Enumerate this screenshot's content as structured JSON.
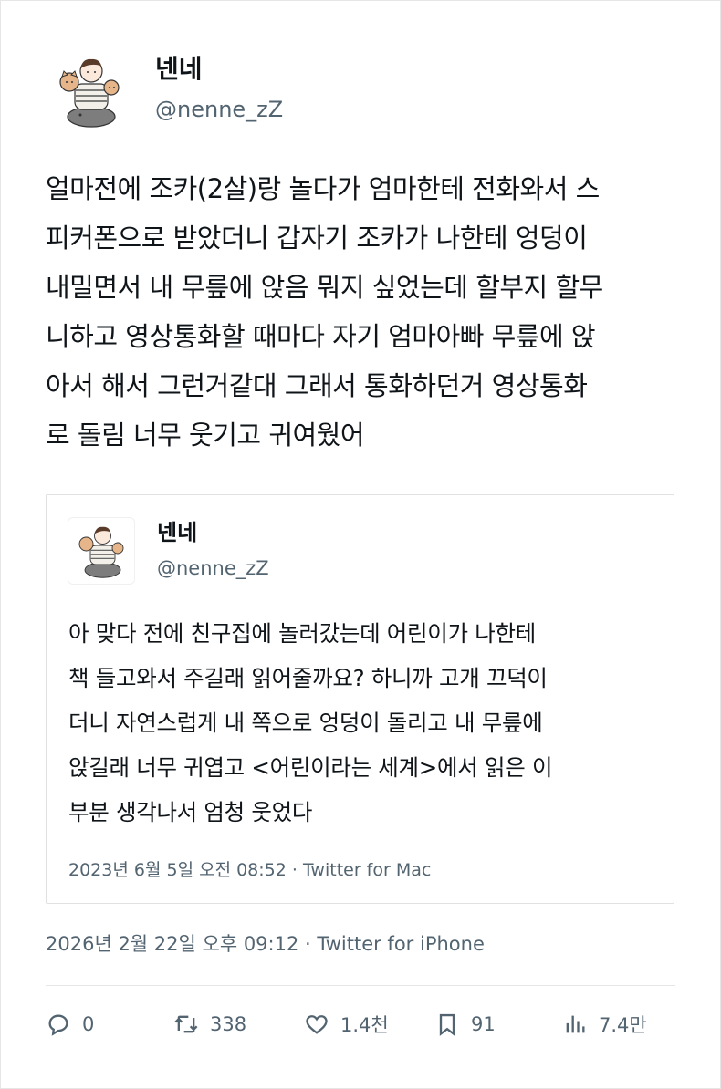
{
  "tweet": {
    "author_name": "넨네",
    "author_handle": "@nenne_zZ",
    "text_lines": [
      "얼마전에 조카(2살)랑 놀다가 엄마한테 전화와서 스",
      "피커폰으로 받았더니 갑자기 조카가 나한테 엉덩이",
      "내밀면서 내 무릎에 앉음 뭐지 싶었는데 할부지 할무",
      "니하고 영상통화할 때마다 자기 엄마아빠 무릎에 앉",
      "아서 해서 그런거같대 그래서 통화하던거 영상통화",
      "로 돌림 너무 웃기고 귀여웠어"
    ],
    "timestamp": "2026년 2월 22일 오후 09:12 · Twitter for iPhone"
  },
  "quote": {
    "author_name": "넨네",
    "author_handle": "@nenne_zZ",
    "text_lines": [
      "아 맞다 전에 친구집에 놀러갔는데 어린이가 나한테",
      "책 들고와서 주길래 읽어줄까요? 하니까 고개 끄덕이",
      "더니 자연스럽게 내 쪽으로 엉덩이 돌리고 내 무릎에",
      "앉길래 너무 귀엽고 <어린이라는 세계>에서 읽은 이",
      "부분 생각나서 엄청 웃었다"
    ],
    "timestamp": "2023년 6월 5일 오전 08:52 · Twitter for Mac"
  },
  "actions": {
    "reply": {
      "icon": "reply-icon",
      "count": "0"
    },
    "retweet": {
      "icon": "retweet-icon",
      "count": "338"
    },
    "like": {
      "icon": "heart-icon",
      "count": "1.4천"
    },
    "bookmark": {
      "icon": "bookmark-icon",
      "count": "91"
    },
    "views": {
      "icon": "views-icon",
      "count": "7.4만"
    }
  },
  "colors": {
    "text": "#0f1419",
    "secondary": "#536471",
    "border": "#e1e1e1"
  }
}
